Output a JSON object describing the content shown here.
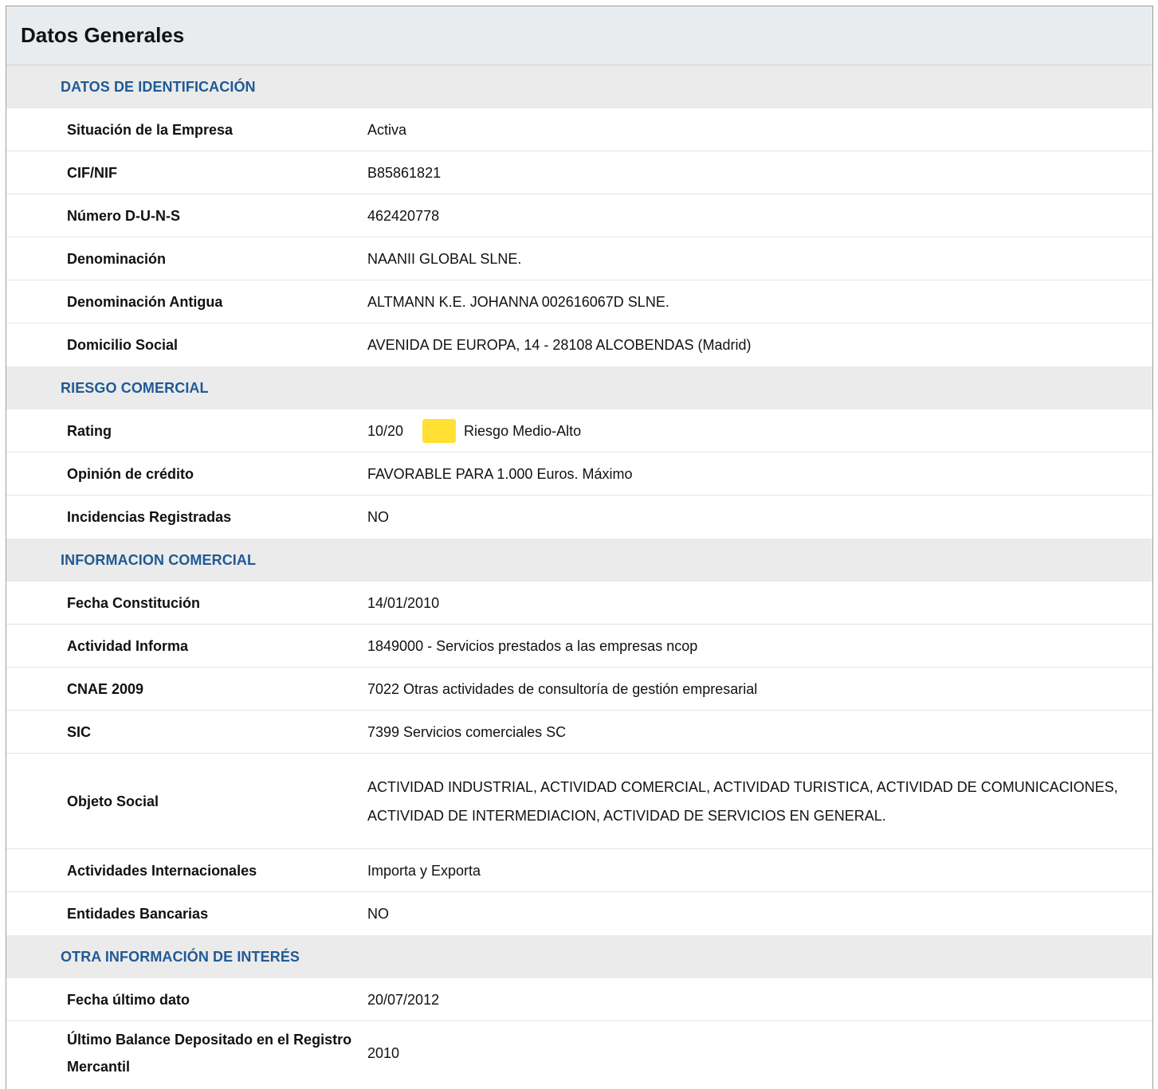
{
  "panel": {
    "title": "Datos Generales"
  },
  "sections": {
    "identificacion": {
      "title": "DATOS DE IDENTIFICACIÓN",
      "rows": {
        "situacion": {
          "label": "Situación de la Empresa",
          "value": "Activa"
        },
        "cif": {
          "label": "CIF/NIF",
          "value": "B85861821"
        },
        "duns": {
          "label": "Número D-U-N-S",
          "value": "462420778"
        },
        "denominacion": {
          "label": "Denominación",
          "value": "NAANII GLOBAL SLNE."
        },
        "denominacion_antigua": {
          "label": "Denominación Antigua",
          "value": "ALTMANN K.E. JOHANNA 002616067D SLNE."
        },
        "domicilio": {
          "label": "Domicilio Social",
          "value": "AVENIDA DE EUROPA, 14 - 28108 ALCOBENDAS (Madrid)"
        }
      }
    },
    "riesgo": {
      "title": "RIESGO COMERCIAL",
      "rows": {
        "rating": {
          "label": "Rating",
          "score": "10/20",
          "risk_text": "Riesgo Medio-Alto",
          "swatch_color": "#ffe033"
        },
        "opinion": {
          "label": "Opinión de crédito",
          "value": "FAVORABLE PARA 1.000 Euros. Máximo"
        },
        "incidencias": {
          "label": "Incidencias Registradas",
          "value": "NO"
        }
      }
    },
    "informacion": {
      "title": "INFORMACION COMERCIAL",
      "rows": {
        "fecha_constitucion": {
          "label": "Fecha Constitución",
          "value": "14/01/2010"
        },
        "actividad_informa": {
          "label": "Actividad Informa",
          "value": "1849000 - Servicios prestados a las empresas ncop"
        },
        "cnae": {
          "label": "CNAE 2009",
          "value": "7022 Otras actividades de consultoría de gestión empresarial"
        },
        "sic": {
          "label": "SIC",
          "value": "7399 Servicios comerciales SC"
        },
        "objeto_social": {
          "label": "Objeto Social",
          "value": "ACTIVIDAD INDUSTRIAL, ACTIVIDAD COMERCIAL, ACTIVIDAD TURISTICA, ACTIVIDAD DE COMUNICACIONES, ACTIVIDAD DE INTERMEDIACION, ACTIVIDAD DE SERVICIOS EN GENERAL."
        },
        "internacionales": {
          "label": "Actividades Internacionales",
          "value": "Importa y Exporta"
        },
        "bancarias": {
          "label": "Entidades Bancarias",
          "value": "NO"
        }
      }
    },
    "otra": {
      "title": "OTRA INFORMACIÓN DE INTERÉS",
      "rows": {
        "fecha_ultimo": {
          "label": "Fecha último dato",
          "value": "20/07/2012"
        },
        "ultimo_balance": {
          "label": "Último Balance Depositado en el Registro Mercantil",
          "value": "2010"
        }
      }
    }
  },
  "colors": {
    "section_title": "#1f5a96",
    "header_bg": "#e9ecef",
    "section_bg": "#ebebeb"
  }
}
